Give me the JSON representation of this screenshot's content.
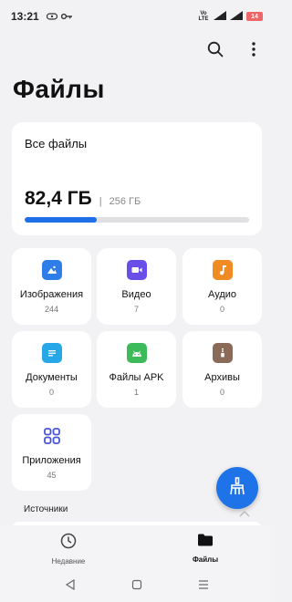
{
  "status_bar": {
    "time": "13:21",
    "volte": "Vo LTE",
    "battery": "14"
  },
  "page": {
    "title": "Файлы"
  },
  "storage": {
    "title": "Все файлы",
    "used": "82,4 ГБ",
    "separator": "|",
    "total": "256 ГБ",
    "used_fraction": 0.32
  },
  "categories": [
    {
      "label": "Изображения",
      "count": "244",
      "icon": "image-icon",
      "color": "#2f7de8"
    },
    {
      "label": "Видео",
      "count": "7",
      "icon": "video-icon",
      "color": "#6a4ee8"
    },
    {
      "label": "Аудио",
      "count": "0",
      "icon": "music-note-icon",
      "color": "#f08a24"
    },
    {
      "label": "Документы",
      "count": "0",
      "icon": "document-icon",
      "color": "#27a7e8"
    },
    {
      "label": "Файлы APK",
      "count": "1",
      "icon": "android-icon",
      "color": "#3dbb5b"
    },
    {
      "label": "Архивы",
      "count": "0",
      "icon": "archive-icon",
      "color": "#8a6a58"
    },
    {
      "label": "Приложения",
      "count": "45",
      "icon": "apps-grid-icon",
      "color": "#4a56d8"
    }
  ],
  "sources": {
    "label": "Источники"
  },
  "bottom_nav": {
    "recent": "Недавние",
    "files": "Файлы"
  },
  "colors": {
    "accent": "#1f73e8",
    "background": "#f2f2f4"
  }
}
